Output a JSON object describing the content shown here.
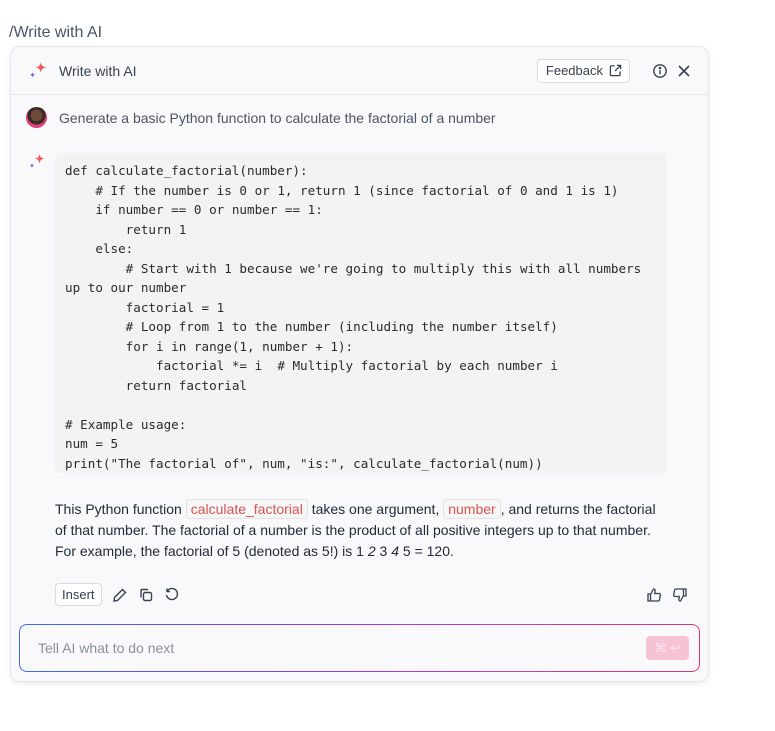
{
  "slash_command": "/Write with AI",
  "header": {
    "title": "Write with AI",
    "feedback_label": "Feedback"
  },
  "conversation": {
    "user_prompt": "Generate a basic Python function to calculate the factorial of a number",
    "code": "def calculate_factorial(number):\n    # If the number is 0 or 1, return 1 (since factorial of 0 and 1 is 1)\n    if number == 0 or number == 1:\n        return 1\n    else:\n        # Start with 1 because we're going to multiply this with all numbers up to our number\n        factorial = 1\n        # Loop from 1 to the number (including the number itself)\n        for i in range(1, number + 1):\n            factorial *= i  # Multiply factorial by each number i\n        return factorial\n\n# Example usage:\nnum = 5\nprint(\"The factorial of\", num, \"is:\", calculate_factorial(num))",
    "explanation": {
      "part1": "This Python function ",
      "code1": "calculate_factorial",
      "part2": " takes one argument, ",
      "code2": "number",
      "part3": ", and returns the factorial of that number. The factorial of a number is the product of all positive integers up to that number. For example, the factorial of 5 (denoted as 5!) is 1 ",
      "italic1": "2",
      "part4": " 3 ",
      "italic2": "4",
      "part5": " 5 = 120."
    }
  },
  "actions": {
    "insert_label": "Insert"
  },
  "prompt": {
    "placeholder": "Tell AI what to do next",
    "value": "",
    "send_shortcut": "⌘ ↩"
  },
  "colors": {
    "accent_pink": "#e0337f",
    "accent_blue": "#3b6bea",
    "inline_code_text": "#d9534f"
  }
}
